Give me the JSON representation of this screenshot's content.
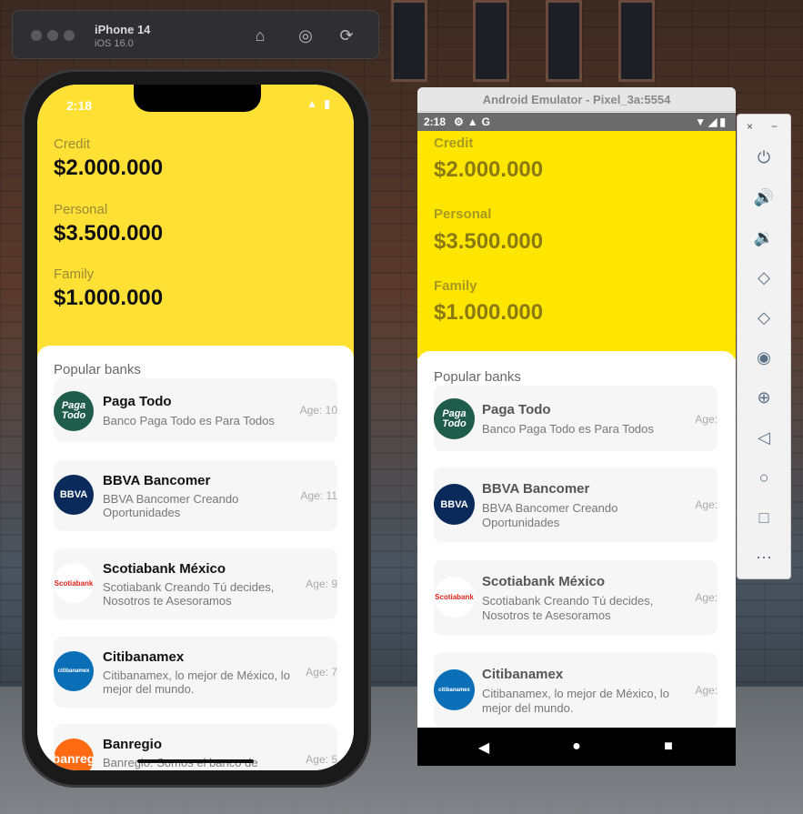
{
  "ios_toolbar": {
    "device_name": "iPhone 14",
    "os_version": "iOS 16.0",
    "buttons": [
      "home-icon",
      "screenshot-icon",
      "rotate-icon"
    ]
  },
  "ios_app": {
    "status_time": "2:18",
    "balances": [
      {
        "label": "Credit",
        "amount": "$2.000.000"
      },
      {
        "label": "Personal",
        "amount": "$3.500.000"
      },
      {
        "label": "Family",
        "amount": "$1.000.000"
      }
    ],
    "section_title": "Popular banks",
    "banks": [
      {
        "name": "Paga Todo",
        "description": "Banco Paga Todo es Para Todos",
        "age": "Age: 10",
        "logo_text": "Paga Todo"
      },
      {
        "name": "BBVA Bancomer",
        "description": "BBVA Bancomer Creando Oportunidades",
        "age": "Age: 11",
        "logo_text": "BBVA"
      },
      {
        "name": "Scotiabank México",
        "description": "Scotiabank Creando Tú decides, Nosotros te Asesoramos",
        "age": "Age: 9",
        "logo_text": "Scotiabank"
      },
      {
        "name": "Citibanamex",
        "description": "Citibanamex, lo mejor de México, lo mejor del mundo.",
        "age": "Age: 7",
        "logo_text": "citibanamex"
      },
      {
        "name": "Banregio",
        "description": "Banregio: Somos el banco de",
        "age": "Age: 5",
        "logo_text": "banreg"
      }
    ]
  },
  "android_emulator": {
    "window_title": "Android Emulator - Pixel_3a:5554",
    "status_time": "2:18",
    "balances": [
      {
        "label": "Credit",
        "amount": "$2.000.000"
      },
      {
        "label": "Personal",
        "amount": "$3.500.000"
      },
      {
        "label": "Family",
        "amount": "$1.000.000"
      }
    ],
    "section_title": "Popular banks",
    "banks": [
      {
        "name": "Paga Todo",
        "description": "Banco Paga Todo es Para Todos",
        "age": "Age:",
        "logo_text": "Paga Todo"
      },
      {
        "name": "BBVA Bancomer",
        "description": "BBVA Bancomer Creando Oportunidades",
        "age": "Age:",
        "logo_text": "BBVA"
      },
      {
        "name": "Scotiabank México",
        "description": "Scotiabank Creando Tú decides, Nosotros te Asesoramos",
        "age": "Age:",
        "logo_text": "Scotiabank"
      },
      {
        "name": "Citibanamex",
        "description": "Citibanamex, lo mejor de México, lo mejor del mundo.",
        "age": "Age:",
        "logo_text": "citibanamex"
      }
    ],
    "side_panel": {
      "close": "×",
      "minimize": "−",
      "buttons": [
        "power-icon",
        "volume-up-icon",
        "volume-down-icon",
        "rotate-left-icon",
        "rotate-right-icon",
        "camera-icon",
        "zoom-icon",
        "back-icon",
        "home-icon",
        "overview-icon",
        "more-icon"
      ]
    }
  },
  "colors": {
    "ios_header": "#ffe135",
    "android_header": "#ffe600",
    "paga_todo": "#1f5c4a",
    "bbva": "#0a2a5c",
    "scotiabank": "#ffffff",
    "citibanamex": "#0b6fb8",
    "banregio": "#ff6a13"
  }
}
